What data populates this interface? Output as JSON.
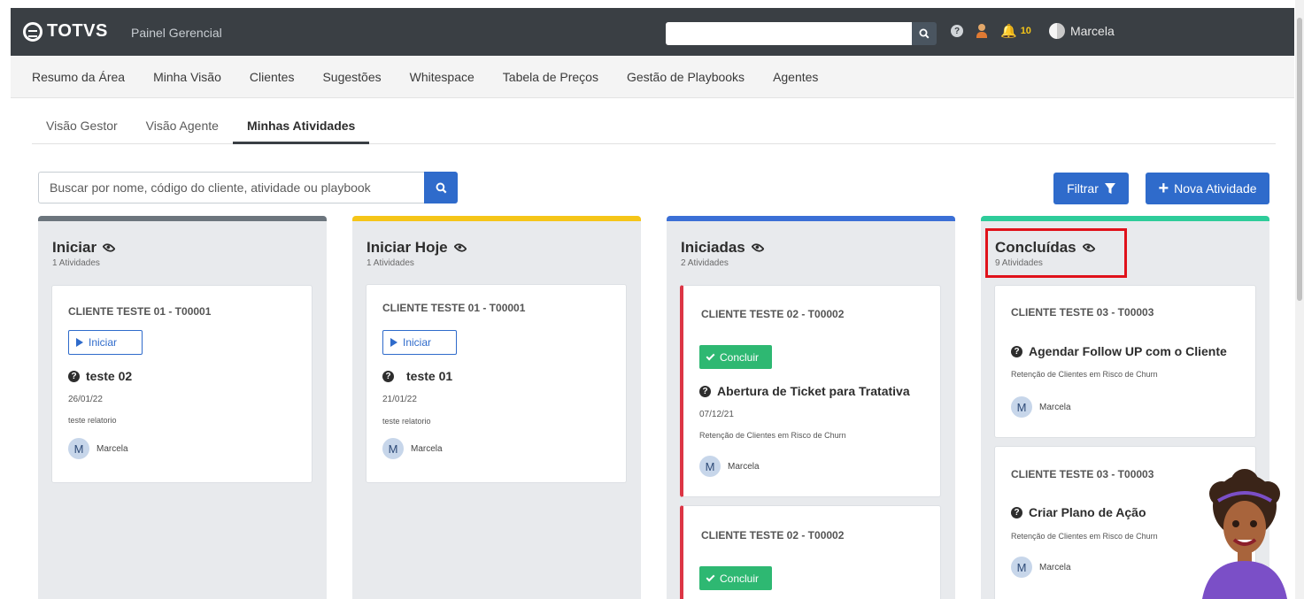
{
  "header": {
    "logo_text": "TOTVS",
    "app_title": "Painel Gerencial",
    "search_placeholder": "",
    "notifications_count": "10",
    "user_name": "Marcela"
  },
  "main_nav": [
    "Resumo da Área",
    "Minha Visão",
    "Clientes",
    "Sugestões",
    "Whitespace",
    "Tabela de Preços",
    "Gestão de Playbooks",
    "Agentes"
  ],
  "sub_tabs": {
    "items": [
      "Visão Gestor",
      "Visão Agente",
      "Minhas Atividades"
    ],
    "active": "Minhas Atividades"
  },
  "toolbar": {
    "search_placeholder": "Buscar por nome, código do cliente, atividade ou playbook",
    "filter_label": "Filtrar",
    "new_activity_label": "Nova Atividade"
  },
  "colors": {
    "accent": "#2f6bcb",
    "iniciar": "#6c757d",
    "iniciar_hoje": "#f5c518",
    "iniciadas": "#3b6fd6",
    "concluidas": "#2ecc9a",
    "highlight": "#e0121b"
  },
  "columns": [
    {
      "title": "Iniciar",
      "count": "1 Atividades",
      "cards": [
        {
          "client": "CLIENTE TESTE 01 - T00001",
          "action": "Iniciar",
          "activity": "teste 02",
          "date": "26/01/22",
          "description": "teste relatorio",
          "owner_initial": "M",
          "owner": "Marcela"
        }
      ]
    },
    {
      "title": "Iniciar Hoje",
      "count": "1 Atividades",
      "cards": [
        {
          "client": "CLIENTE TESTE 01 - T00001",
          "action": "Iniciar",
          "activity": "teste 01",
          "date": "21/01/22",
          "description": "teste relatorio",
          "owner_initial": "M",
          "owner": "Marcela"
        }
      ]
    },
    {
      "title": "Iniciadas",
      "count": "2 Atividades",
      "cards": [
        {
          "client": "CLIENTE TESTE 02 - T00002",
          "action": "Concluir",
          "activity": "Abertura de Ticket para Tratativa",
          "date": "07/12/21",
          "description": "Retenção de Clientes em Risco de Churn",
          "owner_initial": "M",
          "owner": "Marcela"
        },
        {
          "client": "CLIENTE TESTE 02 - T00002",
          "action": "Concluir"
        }
      ]
    },
    {
      "title": "Concluídas",
      "count": "9 Atividades",
      "cards": [
        {
          "client": "CLIENTE TESTE 03 - T00003",
          "activity": "Agendar Follow UP com o Cliente",
          "description": "Retenção de Clientes em Risco de Churn",
          "owner_initial": "M",
          "owner": "Marcela"
        },
        {
          "client": "CLIENTE TESTE 03 - T00003",
          "activity": "Criar Plano de Ação",
          "description": "Retenção de Clientes em Risco de Churn",
          "owner_initial": "M",
          "owner": "Marcela"
        }
      ]
    }
  ]
}
